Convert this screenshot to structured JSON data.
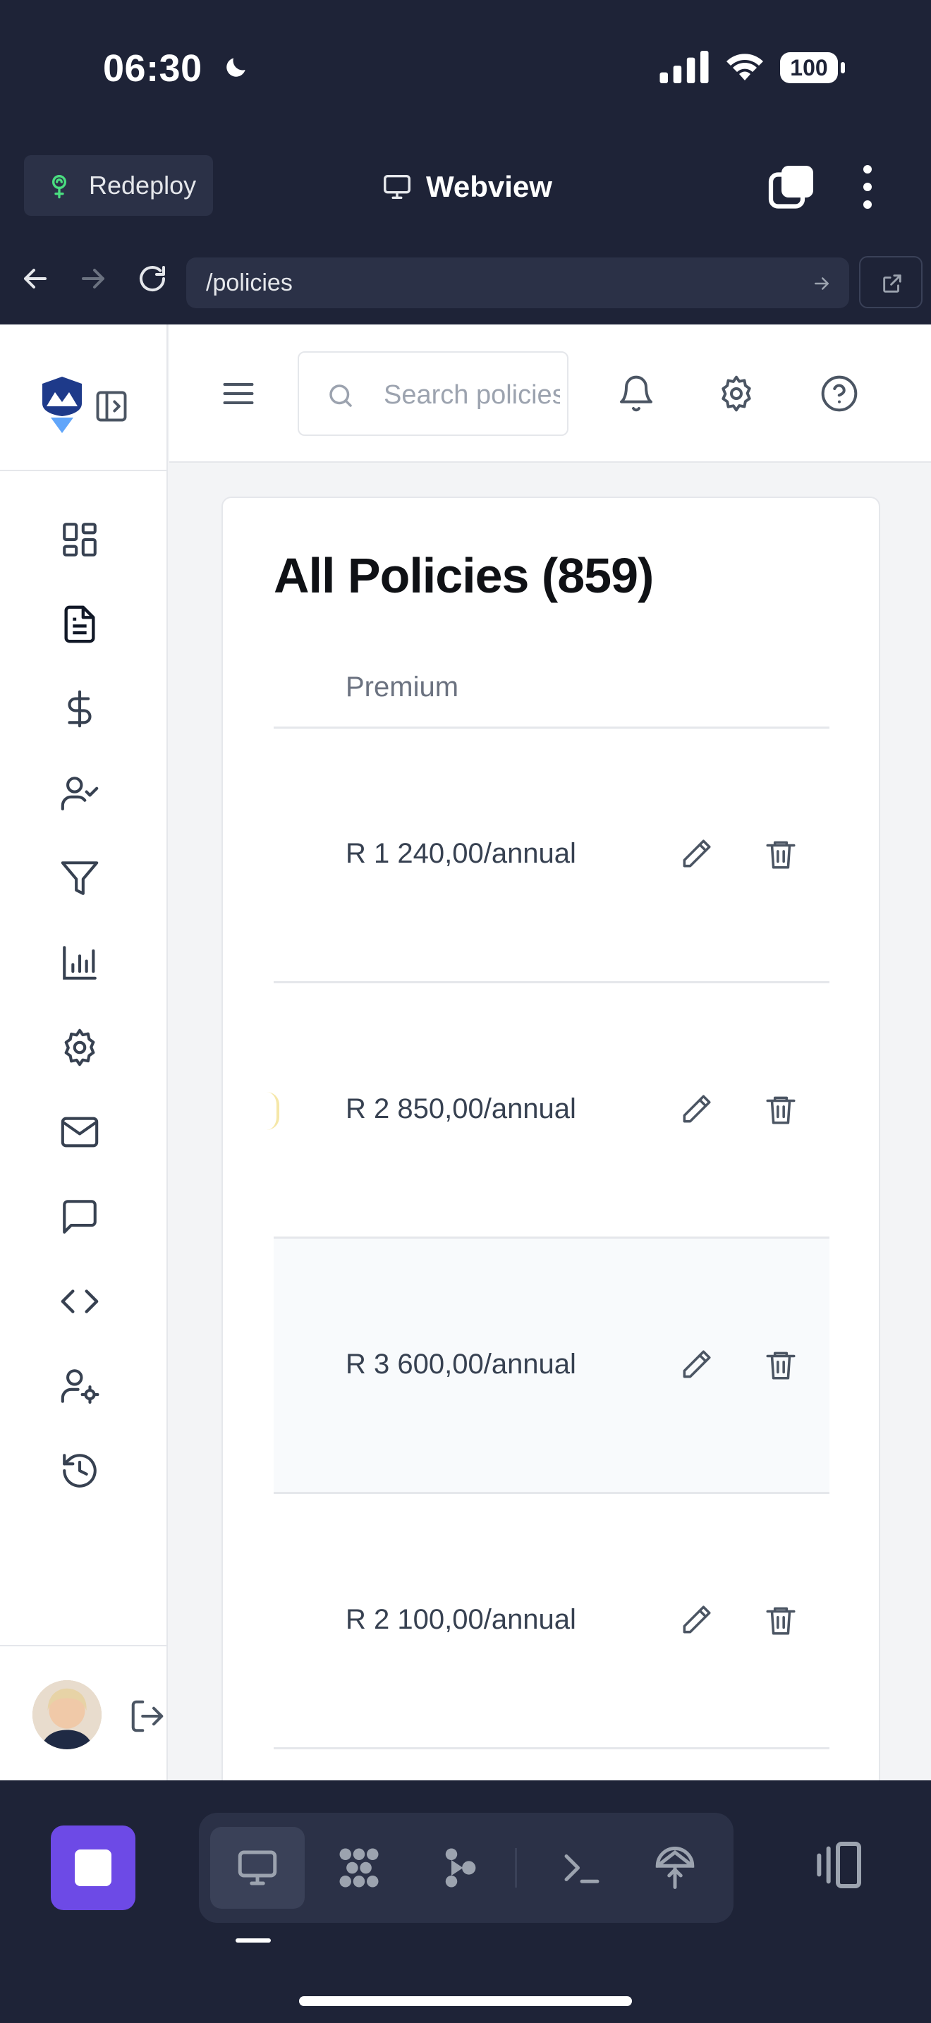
{
  "status_bar": {
    "time": "06:30",
    "battery": "100"
  },
  "top_bar": {
    "redeploy_label": "Redeploy",
    "title": "Webview"
  },
  "url_bar": {
    "path": "/policies"
  },
  "header": {
    "search_placeholder": "Search policies..."
  },
  "card": {
    "title": "All Policies (859)",
    "columns": [
      "Premium"
    ],
    "rows": [
      {
        "premium": "R 1 240,00/annual"
      },
      {
        "premium": "R 2 850,00/annual"
      },
      {
        "premium": "R 3 600,00/annual"
      },
      {
        "premium": "R 2 100,00/annual"
      }
    ]
  },
  "sidebar": {
    "items": [
      "dashboard-icon",
      "policies-icon",
      "dollar-icon",
      "user-check-icon",
      "filter-icon",
      "bar-chart-icon",
      "settings-icon",
      "mail-icon",
      "message-icon",
      "code-icon",
      "user-cog-icon",
      "history-icon"
    ]
  },
  "colors": {
    "chrome": "#1e2337",
    "stop_button": "#6d4ae6",
    "brand": "#1e3a8a"
  }
}
